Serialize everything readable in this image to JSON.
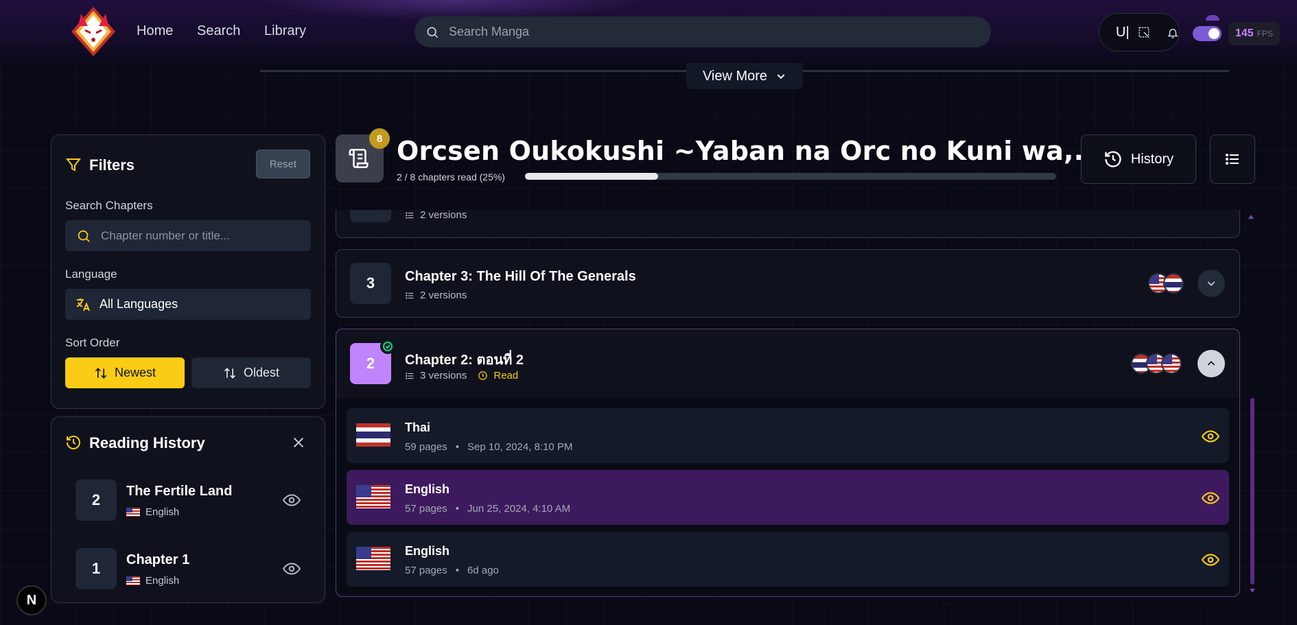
{
  "nav": {
    "home": "Home",
    "search": "Search",
    "library": "Library"
  },
  "search": {
    "placeholder": "Search Manga"
  },
  "topright": {
    "u_text": "U|",
    "fps_value": "145",
    "fps_label": "FPS",
    "toggle_on": true
  },
  "view_more": {
    "label": "View More"
  },
  "filters": {
    "title": "Filters",
    "reset": "Reset",
    "search_label": "Search Chapters",
    "search_placeholder": "Chapter number or title...",
    "language_label": "Language",
    "language_value": "All Languages",
    "sort_label": "Sort Order",
    "newest": "Newest",
    "oldest": "Oldest"
  },
  "reading_history": {
    "title": "Reading History",
    "items": [
      {
        "num": "2",
        "title": "The Fertile Land",
        "lang": "English"
      },
      {
        "num": "1",
        "title": "Chapter 1",
        "lang": "English"
      }
    ]
  },
  "manga": {
    "title": "Orcsen Oukokushi ~Yaban na Orc no Kuni wa,...",
    "badge": "8",
    "progress_text": "2 / 8 chapters read (25%)",
    "progress": 0.25,
    "history_btn": "History"
  },
  "chapters": {
    "partial": {
      "versions": "2 versions"
    },
    "ch3": {
      "num": "3",
      "title": "Chapter 3: The Hill Of The Generals",
      "versions": "2 versions"
    },
    "ch2": {
      "num": "2",
      "title": "Chapter 2: ตอนที่ 2",
      "versions": "3 versions",
      "status": "Read"
    }
  },
  "versions": [
    {
      "lang": "Thai",
      "pages": "59 pages",
      "date": "Sep 10, 2024, 8:10 PM",
      "flag": "th"
    },
    {
      "lang": "English",
      "pages": "57 pages",
      "date": "Jun 25, 2024, 4:10 AM",
      "flag": "us"
    },
    {
      "lang": "English",
      "pages": "57 pages",
      "date": "6d ago",
      "flag": "us"
    }
  ],
  "colors": {
    "accent": "#facc15",
    "purple": "#c084fc",
    "active_row": "#3d1a5e"
  },
  "dev_badge": "N"
}
